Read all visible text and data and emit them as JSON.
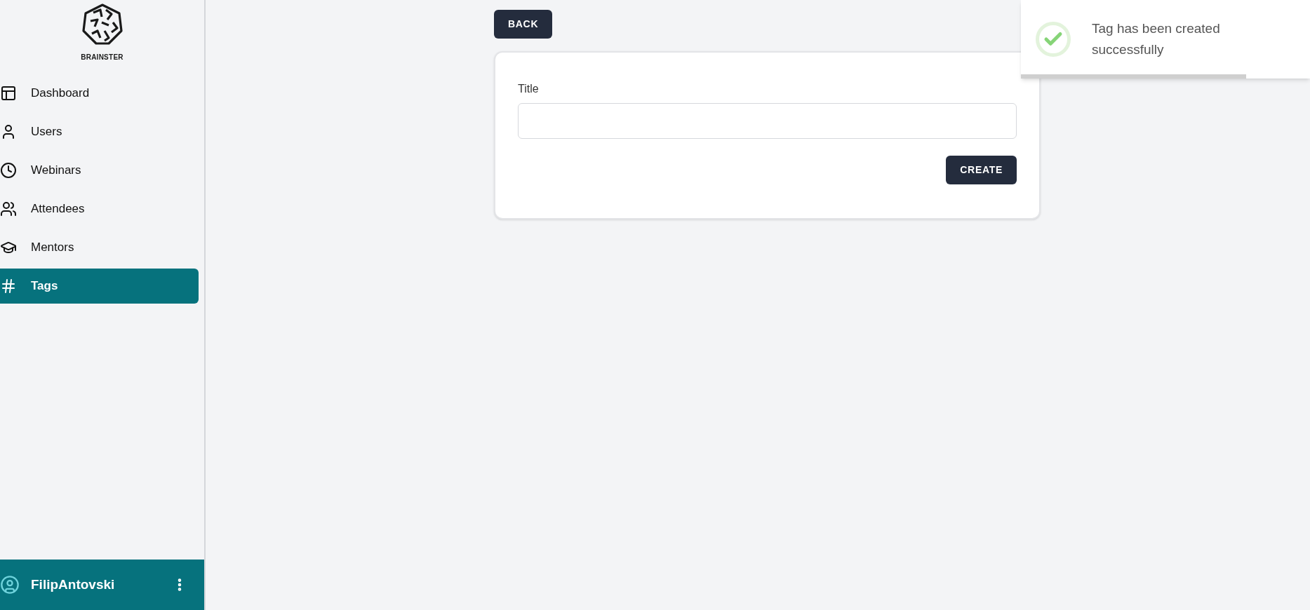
{
  "sidebar": {
    "logo_text": "BRAINSTER",
    "items": [
      {
        "label": "Dashboard",
        "selected": false
      },
      {
        "label": "Users",
        "selected": false
      },
      {
        "label": "Webinars",
        "selected": false
      },
      {
        "label": "Attendees",
        "selected": false
      },
      {
        "label": "Mentors",
        "selected": false
      },
      {
        "label": "Tags",
        "selected": true
      }
    ],
    "user": {
      "name": "FilipAntovski"
    }
  },
  "back_button": "BACK",
  "form": {
    "fields": [
      {
        "label": "Title"
      }
    ],
    "submit": "CREATE"
  },
  "toast": {
    "message": "Tag has been created successfully",
    "level": 0.78
  }
}
